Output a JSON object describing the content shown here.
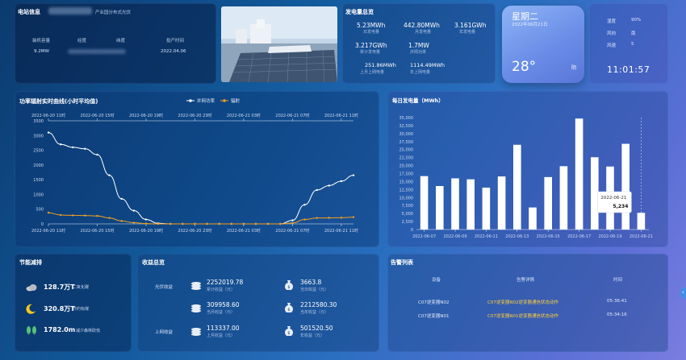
{
  "station": {
    "title": "电站信息",
    "name": "产业园分布式光伏",
    "headers": [
      "装机容量",
      "经度",
      "纬度",
      "投产时间"
    ],
    "values": [
      "9.2MW",
      "",
      "",
      "2022.04.06"
    ]
  },
  "generation": {
    "title": "发电量总览",
    "stats": [
      {
        "value": "5.23MWh",
        "label": "日发电量"
      },
      {
        "value": "442.80MWh",
        "label": "月发电量"
      },
      {
        "value": "3.161GWh",
        "label": "年发电量"
      },
      {
        "value": "3.217GWh",
        "label": "累计发电量"
      },
      {
        "value": "1.7MW",
        "label": "并网功率"
      },
      {
        "value": "251.86MWh",
        "label": "上月上网电量"
      },
      {
        "value": "1114.49MWh",
        "label": "年上网电量"
      }
    ]
  },
  "weather": {
    "weekday": "星期二",
    "date": "2022年06月21日",
    "temperature": "28°",
    "condition": "阴",
    "humidity_label": "湿度",
    "humidity": "90%",
    "wind_dir_label": "风向",
    "wind_dir": "南",
    "wind_speed_label": "风速",
    "wind_speed": "5",
    "time": "11:01:57"
  },
  "power_chart": {
    "title": "功率辐射实时曲线(小时平均值)",
    "legend": [
      "并网功率",
      "辐射"
    ],
    "colors": {
      "power": "#ffffff",
      "radiation": "#f0a020"
    }
  },
  "chart_data": [
    {
      "type": "line",
      "title": "功率辐射实时曲线(小时平均值)",
      "x": [
        "2022-06-20 11时",
        "2022-06-20 12时",
        "2022-06-20 13时",
        "2022-06-20 14时",
        "2022-06-20 15时",
        "2022-06-20 16时",
        "2022-06-20 17时",
        "2022-06-20 18时",
        "2022-06-20 19时",
        "2022-06-20 20时",
        "2022-06-20 21时",
        "2022-06-20 22时",
        "2022-06-20 23时",
        "2022-06-21 00时",
        "2022-06-21 01时",
        "2022-06-21 02时",
        "2022-06-21 03时",
        "2022-06-21 04时",
        "2022-06-21 05时",
        "2022-06-21 06时",
        "2022-06-21 07时",
        "2022-06-21 08时",
        "2022-06-21 09时",
        "2022-06-21 10时",
        "2022-06-21 11时"
      ],
      "x_ticks": [
        "2022-06-20 11时",
        "2022-06-20 15时",
        "2022-06-20 19时",
        "2022-06-20 23时",
        "2022-06-21 03时",
        "2022-06-21 07时",
        "2022-06-21 11时"
      ],
      "x_ticks_bottom": [
        "2022-06-20 11时",
        "2022-06-20 15时",
        "2022-06-20 19时",
        "2022-06-20 23时",
        "2022-06-21 03时",
        "2022-06-21 07时",
        "2022-06-21 11时"
      ],
      "ylim": [
        0,
        3500
      ],
      "yticks": [
        0,
        500,
        1000,
        1500,
        2000,
        2500,
        3000,
        3500
      ],
      "series": [
        {
          "name": "并网功率",
          "values": [
            3100,
            2700,
            2600,
            2550,
            2350,
            1650,
            850,
            450,
            150,
            20,
            0,
            0,
            0,
            0,
            0,
            0,
            0,
            0,
            0,
            0,
            120,
            650,
            1150,
            1300,
            1450,
            1650
          ]
        },
        {
          "name": "辐射",
          "values": [
            380,
            300,
            290,
            285,
            270,
            200,
            100,
            40,
            10,
            0,
            0,
            0,
            0,
            0,
            0,
            0,
            0,
            0,
            0,
            0,
            30,
            150,
            200,
            205,
            210,
            230
          ]
        }
      ]
    },
    {
      "type": "bar",
      "title": "每日发电量（MWh）",
      "categories": [
        "2022-06-07",
        "2022-06-08",
        "2022-06-09",
        "2022-06-10",
        "2022-06-11",
        "2022-06-12",
        "2022-06-13",
        "2022-06-14",
        "2022-06-15",
        "2022-06-16",
        "2022-06-17",
        "2022-06-18",
        "2022-06-19",
        "2022-06-20",
        "2022-06-21"
      ],
      "x_ticks": [
        "2022-06-07",
        "2022-06-09",
        "2022-06-11",
        "2022-06-13",
        "2022-06-15",
        "2022-06-17",
        "2022-06-19",
        "2022-06-21"
      ],
      "values": [
        16700,
        13600,
        16000,
        15700,
        13100,
        16600,
        26500,
        6900,
        16400,
        19800,
        34700,
        22600,
        19700,
        26800,
        5234
      ],
      "ylim": [
        0,
        35000
      ],
      "yticks": [
        0,
        2500,
        5000,
        7500,
        10000,
        12500,
        15000,
        17500,
        20000,
        22500,
        25000,
        27500,
        30000,
        32500,
        35000
      ],
      "tooltip": {
        "label": "2022-06-21",
        "value": "5,234"
      },
      "color": "#ffffff"
    }
  ],
  "energy_saving": {
    "title": "节能减排",
    "items": [
      {
        "icon": "cloud-icon",
        "value": "128.7万T",
        "label": "二氧化碳"
      },
      {
        "icon": "moon-icon",
        "value": "320.8万T",
        "label": "节约标煤"
      },
      {
        "icon": "tree-icon",
        "value": "1782.0m",
        "label": "减少森林砍伐"
      }
    ]
  },
  "revenue": {
    "title": "收益总览",
    "row_labels": [
      "光伏收益",
      "",
      "上网收益"
    ],
    "cells": [
      {
        "value": "2252019.78",
        "label": "累计收益（元）"
      },
      {
        "value": "3663.8",
        "label": "当日收益（元）"
      },
      {
        "value": "309958.60",
        "label": "当月收益（元）"
      },
      {
        "value": "2212580.30",
        "label": "当年收益（元）"
      },
      {
        "value": "113337.00",
        "label": "上月收益（元）"
      },
      {
        "value": "501520.50",
        "label": "年收益（元）"
      }
    ]
  },
  "alarms": {
    "title": "告警列表",
    "headers": [
      "设备",
      "告警详情",
      "时间"
    ],
    "rows": [
      {
        "device": "C07逆变器N02",
        "detail": "C07逆变器N02逆变器通信状态动作",
        "time": "05:36:41"
      },
      {
        "device": "C07逆变器N01",
        "detail": "C07逆变器N01逆变器通信状态动作",
        "time": "05:34:16"
      }
    ],
    "detail_color": "#ffd23a"
  }
}
